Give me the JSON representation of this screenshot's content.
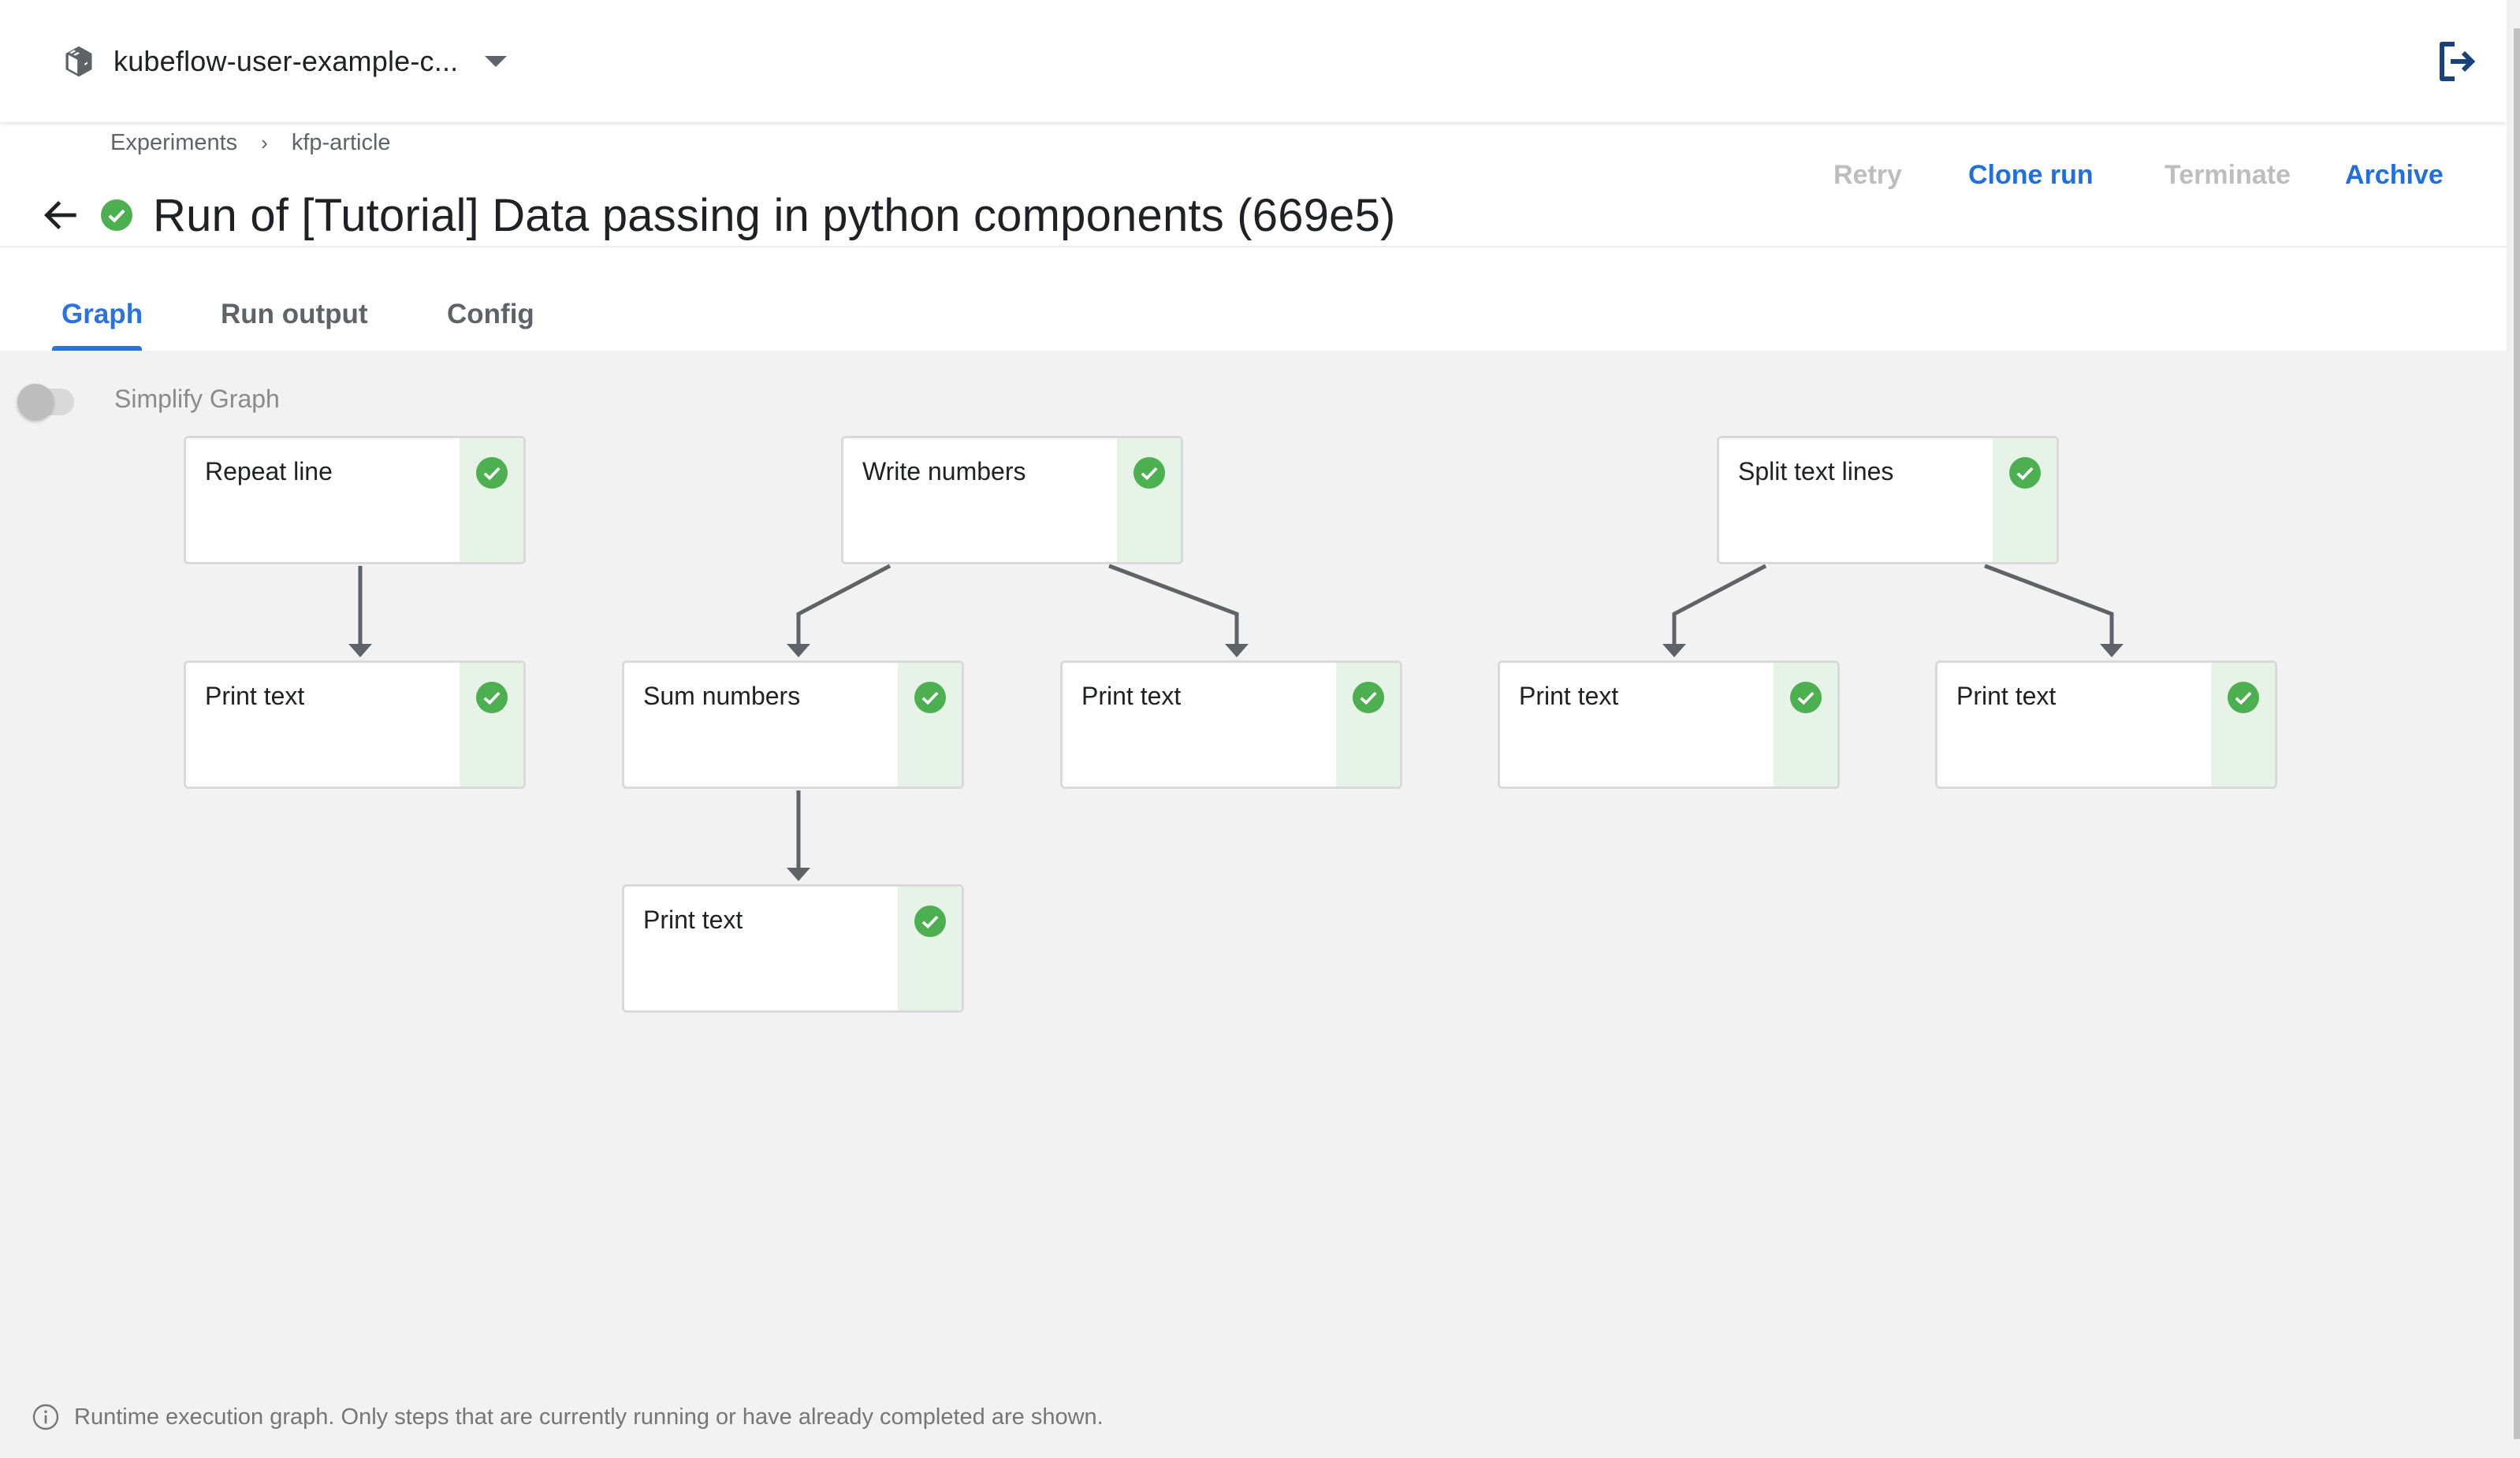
{
  "topbar": {
    "namespace": "kubeflow-user-example-c...",
    "namespace_icon": "cube-icon",
    "dropdown_icon": "caret-down-icon",
    "logout_icon": "logout-icon"
  },
  "breadcrumb": [
    {
      "label": "Experiments"
    },
    {
      "label": "kfp-article"
    }
  ],
  "breadcrumb_separator": "›",
  "run": {
    "title": "Run of [Tutorial] Data passing in python components (669e5)",
    "status": "succeeded",
    "status_color": "#4caf50"
  },
  "actions": [
    {
      "label": "Retry",
      "enabled": false
    },
    {
      "label": "Clone run",
      "enabled": true
    },
    {
      "label": "Terminate",
      "enabled": false
    },
    {
      "label": "Archive",
      "enabled": true
    }
  ],
  "tabs": [
    {
      "label": "Graph",
      "active": true
    },
    {
      "label": "Run output",
      "active": false
    },
    {
      "label": "Config",
      "active": false
    }
  ],
  "graph": {
    "simplify_toggle": {
      "label": "Simplify Graph",
      "on": false
    },
    "nodes": [
      {
        "id": "repeat-line",
        "label": "Repeat line",
        "status": "succeeded"
      },
      {
        "id": "print-text-1",
        "label": "Print text",
        "status": "succeeded"
      },
      {
        "id": "write-numbers",
        "label": "Write numbers",
        "status": "succeeded"
      },
      {
        "id": "sum-numbers",
        "label": "Sum numbers",
        "status": "succeeded"
      },
      {
        "id": "print-text-2",
        "label": "Print text",
        "status": "succeeded"
      },
      {
        "id": "print-text-3",
        "label": "Print text",
        "status": "succeeded"
      },
      {
        "id": "split-text-lines",
        "label": "Split text lines",
        "status": "succeeded"
      },
      {
        "id": "print-text-4",
        "label": "Print text",
        "status": "succeeded"
      },
      {
        "id": "print-text-5",
        "label": "Print text",
        "status": "succeeded"
      }
    ],
    "edges": [
      {
        "from": "repeat-line",
        "to": "print-text-1"
      },
      {
        "from": "write-numbers",
        "to": "sum-numbers"
      },
      {
        "from": "write-numbers",
        "to": "print-text-2"
      },
      {
        "from": "sum-numbers",
        "to": "print-text-3"
      },
      {
        "from": "split-text-lines",
        "to": "print-text-4"
      },
      {
        "from": "split-text-lines",
        "to": "print-text-5"
      }
    ],
    "footer_note": "Runtime execution graph. Only steps that are currently running or have already completed are shown."
  }
}
